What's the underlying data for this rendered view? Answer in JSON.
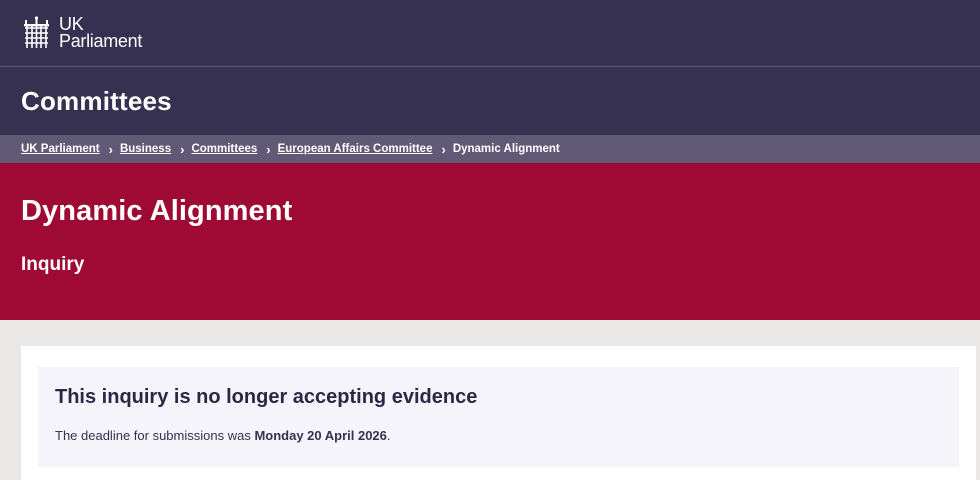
{
  "brand": {
    "line1": "UK",
    "line2": "Parliament",
    "logo_icon": "portcullis-icon"
  },
  "section": {
    "title": "Committees"
  },
  "breadcrumb": {
    "items": [
      {
        "label": "UK Parliament"
      },
      {
        "label": "Business"
      },
      {
        "label": "Committees"
      },
      {
        "label": "European Affairs Committee"
      }
    ],
    "current": "Dynamic Alignment",
    "separator_icon": "chevron-right-icon"
  },
  "hero": {
    "title": "Dynamic Alignment",
    "subtitle": "Inquiry"
  },
  "notice": {
    "heading": "This inquiry is no longer accepting evidence",
    "text_prefix": "The deadline for submissions was ",
    "deadline": "Monday 20 April 2026",
    "text_suffix": "."
  },
  "colors": {
    "header_bg": "#373151",
    "breadcrumb_bg": "#615a77",
    "hero_bg": "#9e0a33",
    "page_bg": "#e9e8e6",
    "notice_bg": "#f5f4fa"
  }
}
